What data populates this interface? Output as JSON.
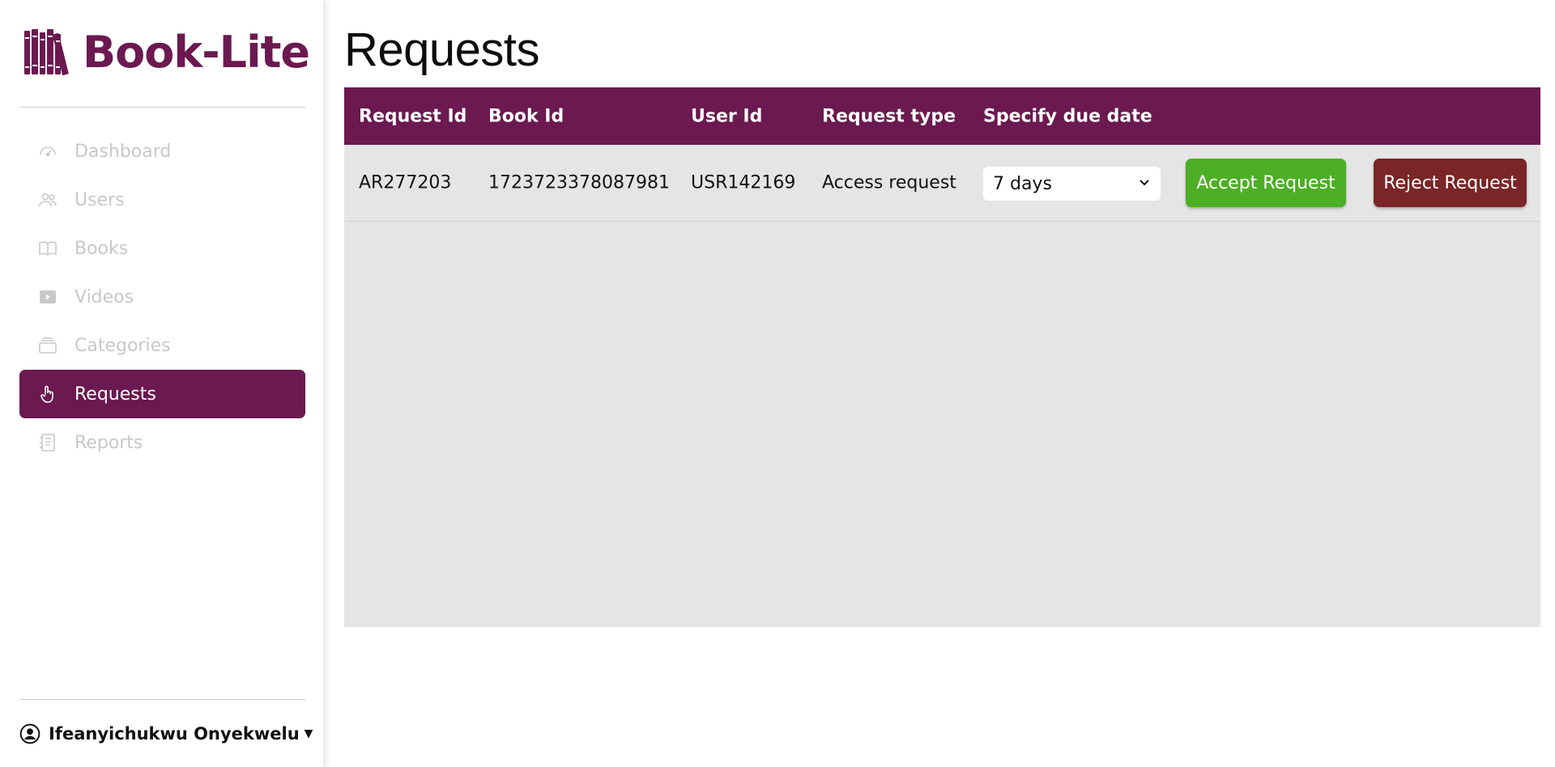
{
  "app": {
    "name": "Book-Lite",
    "brand_color": "#6b1950"
  },
  "sidebar": {
    "items": [
      {
        "label": "Dashboard",
        "icon": "gauge-icon",
        "active": false
      },
      {
        "label": "Users",
        "icon": "users-icon",
        "active": false
      },
      {
        "label": "Books",
        "icon": "book-icon",
        "active": false
      },
      {
        "label": "Videos",
        "icon": "video-icon",
        "active": false
      },
      {
        "label": "Categories",
        "icon": "stack-icon",
        "active": false
      },
      {
        "label": "Requests",
        "icon": "hand-pointer-icon",
        "active": true
      },
      {
        "label": "Reports",
        "icon": "report-icon",
        "active": false
      }
    ],
    "user_name": "Ifeanyichukwu Onyekwelu"
  },
  "main": {
    "title": "Requests",
    "table": {
      "headers": [
        "Request Id",
        "Book Id",
        "User Id",
        "Request type",
        "Specify due date"
      ],
      "rows": [
        {
          "request_id": "AR277203",
          "book_id": "1723723378087981",
          "user_id": "USR142169",
          "request_type": "Access request",
          "due_date": "7 days",
          "accept_label": "Accept Request",
          "reject_label": "Reject Request"
        }
      ]
    }
  },
  "colors": {
    "accept": "#4caf25",
    "reject": "#7a2527",
    "panel": "#e5e5e5"
  }
}
